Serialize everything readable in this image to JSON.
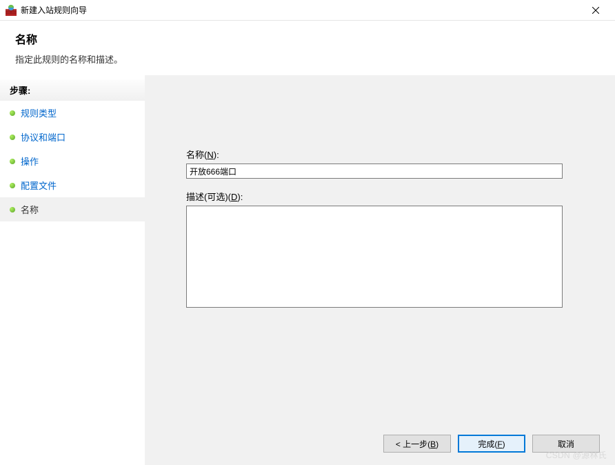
{
  "window": {
    "title": "新建入站规则向导"
  },
  "header": {
    "title": "名称",
    "subtitle": "指定此规则的名称和描述。"
  },
  "sidebar": {
    "steps_label": "步骤:",
    "items": [
      {
        "label": "规则类型"
      },
      {
        "label": "协议和端口"
      },
      {
        "label": "操作"
      },
      {
        "label": "配置文件"
      },
      {
        "label": "名称"
      }
    ]
  },
  "form": {
    "name_label_pre": "名称(",
    "name_label_key": "N",
    "name_label_post": "):",
    "name_value": "开放666端口",
    "desc_label_pre": "描述(可选)(",
    "desc_label_key": "D",
    "desc_label_post": "):",
    "desc_value": ""
  },
  "footer": {
    "back_pre": "< 上一步(",
    "back_key": "B",
    "back_post": ")",
    "finish_pre": "完成(",
    "finish_key": "F",
    "finish_post": ")",
    "cancel": "取消"
  },
  "watermark": "CSDN @源林氏"
}
